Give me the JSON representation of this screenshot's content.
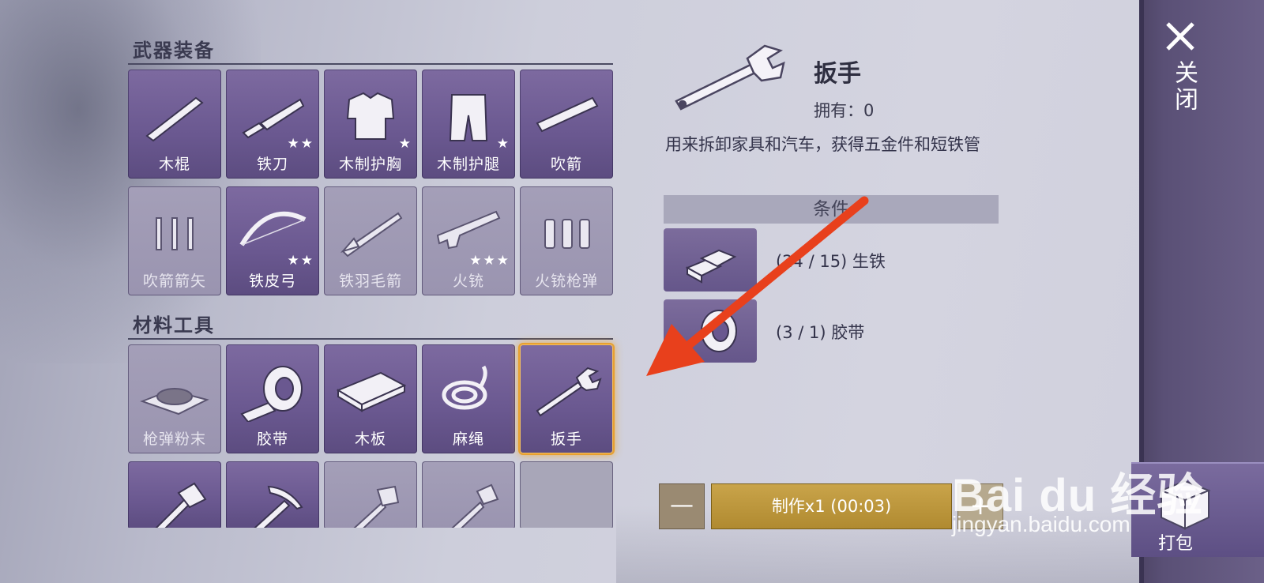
{
  "sections": {
    "weapons_title": "武器装备",
    "materials_title": "材料工具"
  },
  "weapons": [
    {
      "label": "木棍",
      "stars": "",
      "state": "active",
      "icon": "wooden-stick-icon"
    },
    {
      "label": "铁刀",
      "stars": "★★",
      "state": "active",
      "icon": "iron-knife-icon"
    },
    {
      "label": "木制护胸",
      "stars": "★",
      "state": "active",
      "icon": "wooden-chestplate-icon"
    },
    {
      "label": "木制护腿",
      "stars": "★",
      "state": "active",
      "icon": "wooden-leggings-icon"
    },
    {
      "label": "吹箭",
      "stars": "",
      "state": "active",
      "icon": "blowgun-icon"
    },
    {
      "label": "吹箭箭矢",
      "stars": "",
      "state": "dim",
      "icon": "blowgun-darts-icon"
    },
    {
      "label": "铁皮弓",
      "stars": "★★",
      "state": "active",
      "icon": "iron-bow-icon"
    },
    {
      "label": "铁羽毛箭",
      "stars": "",
      "state": "dim",
      "icon": "feather-arrow-icon"
    },
    {
      "label": "火铳",
      "stars": "★★★",
      "state": "dim",
      "icon": "musket-icon"
    },
    {
      "label": "火铳枪弹",
      "stars": "",
      "state": "dim",
      "icon": "musket-bullets-icon"
    }
  ],
  "materials": [
    {
      "label": "枪弹粉末",
      "state": "dim",
      "icon": "gunpowder-icon"
    },
    {
      "label": "胶带",
      "state": "active",
      "icon": "tape-icon"
    },
    {
      "label": "木板",
      "state": "active",
      "icon": "plank-icon"
    },
    {
      "label": "麻绳",
      "state": "active",
      "icon": "rope-icon"
    },
    {
      "label": "扳手",
      "state": "selected",
      "icon": "wrench-icon"
    }
  ],
  "tools_partial": [
    {
      "state": "active",
      "icon": "axe-icon"
    },
    {
      "state": "active",
      "icon": "pickaxe-icon"
    },
    {
      "state": "dim",
      "icon": "stone-hammer-icon"
    },
    {
      "state": "dim",
      "icon": "stone-axe-icon"
    },
    {
      "state": "empty",
      "icon": ""
    }
  ],
  "detail": {
    "name": "扳手",
    "owned": "拥有：0",
    "description": "用来拆卸家具和汽车，获得五金件和短铁管",
    "conditions_label": "条件",
    "requirements": [
      {
        "text": "(24 / 15) 生铁",
        "icon": "pig-iron-icon"
      },
      {
        "text": "(3 / 1) 胶带",
        "icon": "tape-icon"
      }
    ]
  },
  "craft": {
    "minus": "—",
    "button": "制作x1 (00:03)",
    "plus": "+"
  },
  "rail": {
    "close": "关闭",
    "pack": "打包"
  },
  "watermark": {
    "main": "Bai du 经验",
    "sub": "jingyan.baidu.com"
  },
  "colors": {
    "slot_active": "#6a5890",
    "slot_selected_glow": "#e8a030",
    "craft_button": "#b08a30",
    "arrow": "#e8401c"
  }
}
